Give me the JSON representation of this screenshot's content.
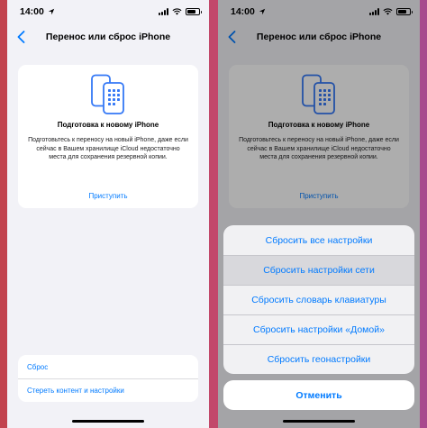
{
  "status": {
    "time": "14:00"
  },
  "screen": {
    "title": "Перенос или сброс iPhone",
    "card": {
      "title": "Подготовка к новому iPhone",
      "description": "Подготовьтесь к переносу на новый iPhone, даже если сейчас в Вашем хранилище iCloud недостаточно места для сохранения резервной копии.",
      "action": "Приступить"
    },
    "list": [
      {
        "label": "Сброс"
      },
      {
        "label": "Стереть контент и настройки"
      }
    ]
  },
  "action_sheet": {
    "items": [
      {
        "label": "Сбросить все настройки"
      },
      {
        "label": "Сбросить настройки сети"
      },
      {
        "label": "Сбросить словарь клавиатуры"
      },
      {
        "label": "Сбросить настройки «Домой»"
      },
      {
        "label": "Сбросить геонастройки"
      }
    ],
    "highlighted_index": 1,
    "cancel": "Отменить"
  },
  "colors": {
    "accent": "#007aff",
    "background": "#f2f2f7"
  },
  "icons": [
    "location-arrow-icon",
    "signal-icon",
    "wifi-icon",
    "battery-icon",
    "chevron-left-icon",
    "two-phones-icon"
  ]
}
